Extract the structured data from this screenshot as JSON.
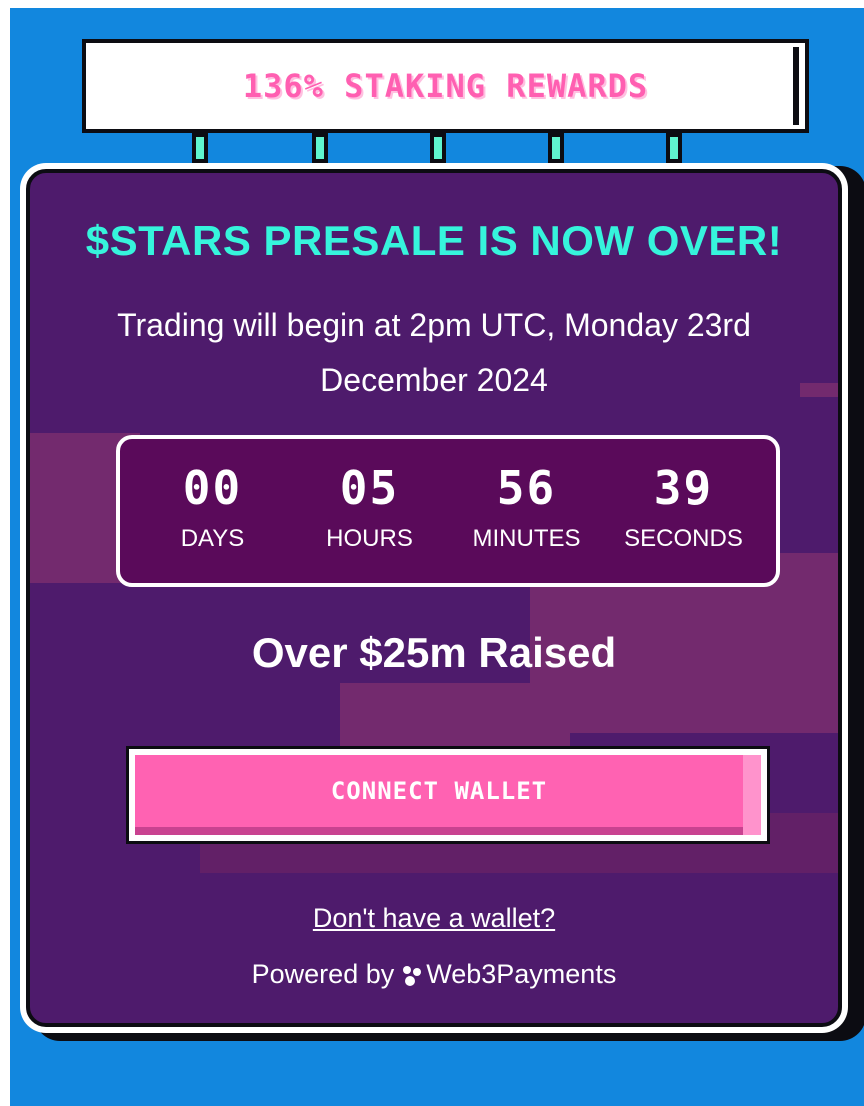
{
  "banner": {
    "text": "136% STAKING REWARDS"
  },
  "card": {
    "title": "$STARS PRESALE IS NOW OVER!",
    "subtitle": "Trading will begin at 2pm UTC, Monday 23rd December 2024"
  },
  "countdown": [
    {
      "value": "00",
      "label": "DAYS"
    },
    {
      "value": "05",
      "label": "HOURS"
    },
    {
      "value": "56",
      "label": "MINUTES"
    },
    {
      "value": "39",
      "label": "SECONDS"
    }
  ],
  "raised": "Over $25m Raised",
  "connect_button": "CONNECT WALLET",
  "no_wallet_link": "Don't have a wallet?",
  "powered_by": {
    "prefix": "Powered by",
    "brand": "Web3Payments",
    "icon": "web3payments-logo-icon"
  },
  "colors": {
    "background": "#1287de",
    "card": "#4e1b6c",
    "title": "#36f4dc",
    "accent_pink": "#ff62b2",
    "timer_box": "#5a0a5a"
  }
}
